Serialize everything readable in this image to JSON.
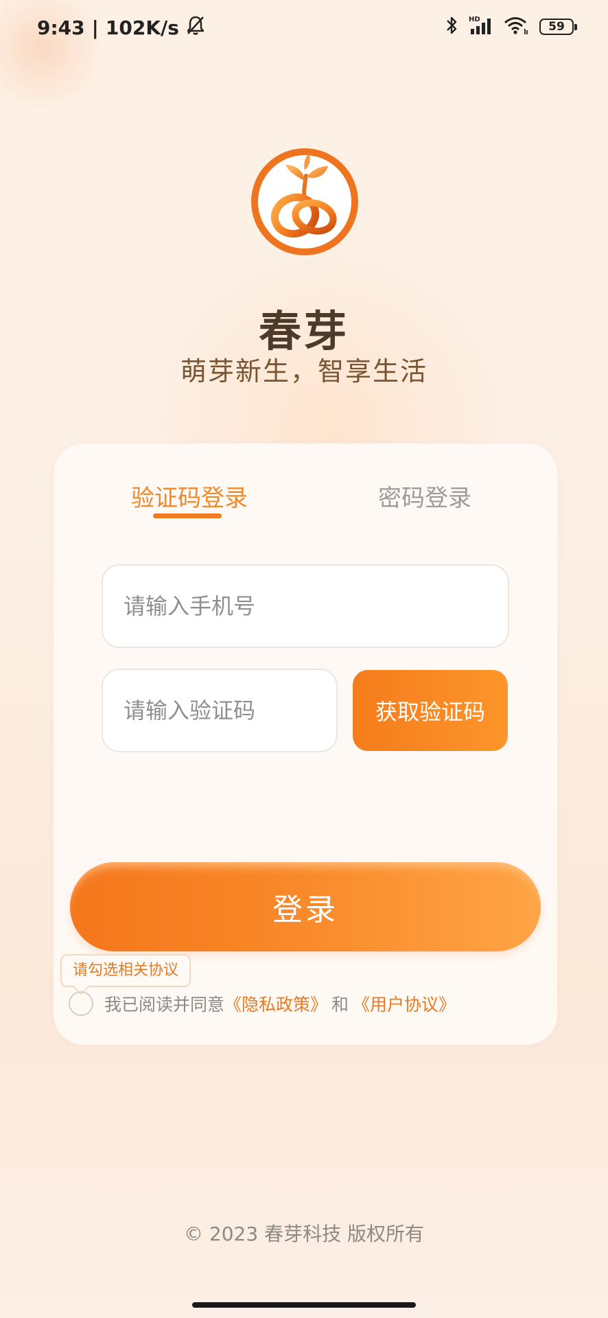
{
  "status_bar": {
    "time": "9:43",
    "separator": "|",
    "network_speed": "102K/s",
    "network_type": "HD",
    "battery": "59",
    "icons": [
      "mute-bell-icon",
      "bluetooth-icon",
      "signal-icon",
      "wifi-icon",
      "battery-icon"
    ]
  },
  "brand": {
    "name": "春芽",
    "slogan": "萌芽新生，智享生活",
    "logo_icon": "sprout-ring-logo",
    "accent_color": "#EF7B22"
  },
  "login": {
    "tabs": [
      {
        "label": "验证码登录",
        "active": true
      },
      {
        "label": "密码登录",
        "active": false
      }
    ],
    "phone_placeholder": "请输入手机号",
    "phone_value": "",
    "code_placeholder": "请输入验证码",
    "code_value": "",
    "get_code_label": "获取验证码",
    "submit_label": "登录",
    "agreement_hint": "请勾选相关协议",
    "agreement_text": "我已阅读并同意",
    "privacy_link": "《隐私政策》",
    "and_text": "和",
    "terms_link": "《用户协议》",
    "agreement_checked": false
  },
  "footer": {
    "copyright": "© 2023 春芽科技 版权所有"
  }
}
